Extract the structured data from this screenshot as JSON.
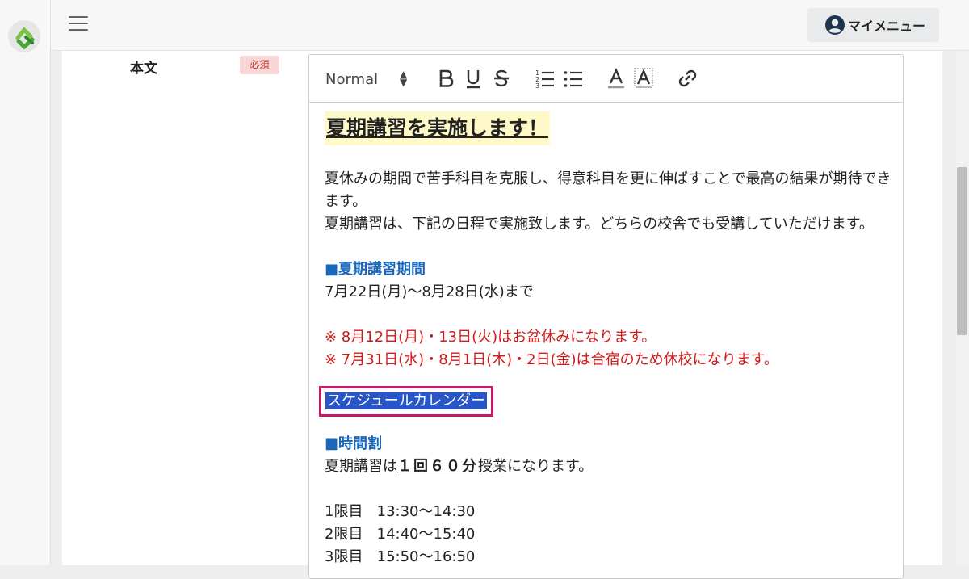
{
  "header": {
    "menu_icon": "hamburger-icon",
    "my_menu_label": "マイメニュー",
    "user_icon": "user-circle-icon"
  },
  "form": {
    "field_label": "本文",
    "required_badge": "必須"
  },
  "toolbar": {
    "format_select": "Normal",
    "buttons": [
      "bold",
      "underline",
      "strike",
      "ordered-list",
      "bullet-list",
      "text-color",
      "background-color",
      "link"
    ]
  },
  "content": {
    "title": "夏期講習を実施します！",
    "para1": "夏休みの期間で苦手科目を克服し、得意科目を更に伸ばすことで最高の結果が期待できます。",
    "para2": "夏期講習は、下記の日程で実施致します。どちらの校舎でも受講していただけます。",
    "period_heading": "■夏期講習期間",
    "period": "7月22日(月)〜8月28日(水)まで",
    "note1": "※ 8月12日(月)・13日(火)はお盆休みになります。",
    "note2": "※ 7月31日(水)・8月1日(木)・2日(金)は合宿のため休校になります。",
    "calendar_link": "スケジュールカレンダー",
    "timetable_heading": "■時間割",
    "lesson_prefix": "夏期講習は",
    "lesson_bold": "１回６０分",
    "lesson_suffix": "授業になります。",
    "periods": [
      "1限目   13:30〜14:30",
      "2限目   14:40〜15:40",
      "3限目   15:50〜16:50"
    ]
  },
  "colors": {
    "heading_blue": "#1a66b8",
    "note_red": "#d11a1a",
    "highlight_yellow": "#fff8c8",
    "selection_blue": "#2855c8",
    "focus_border": "#c8186a"
  }
}
